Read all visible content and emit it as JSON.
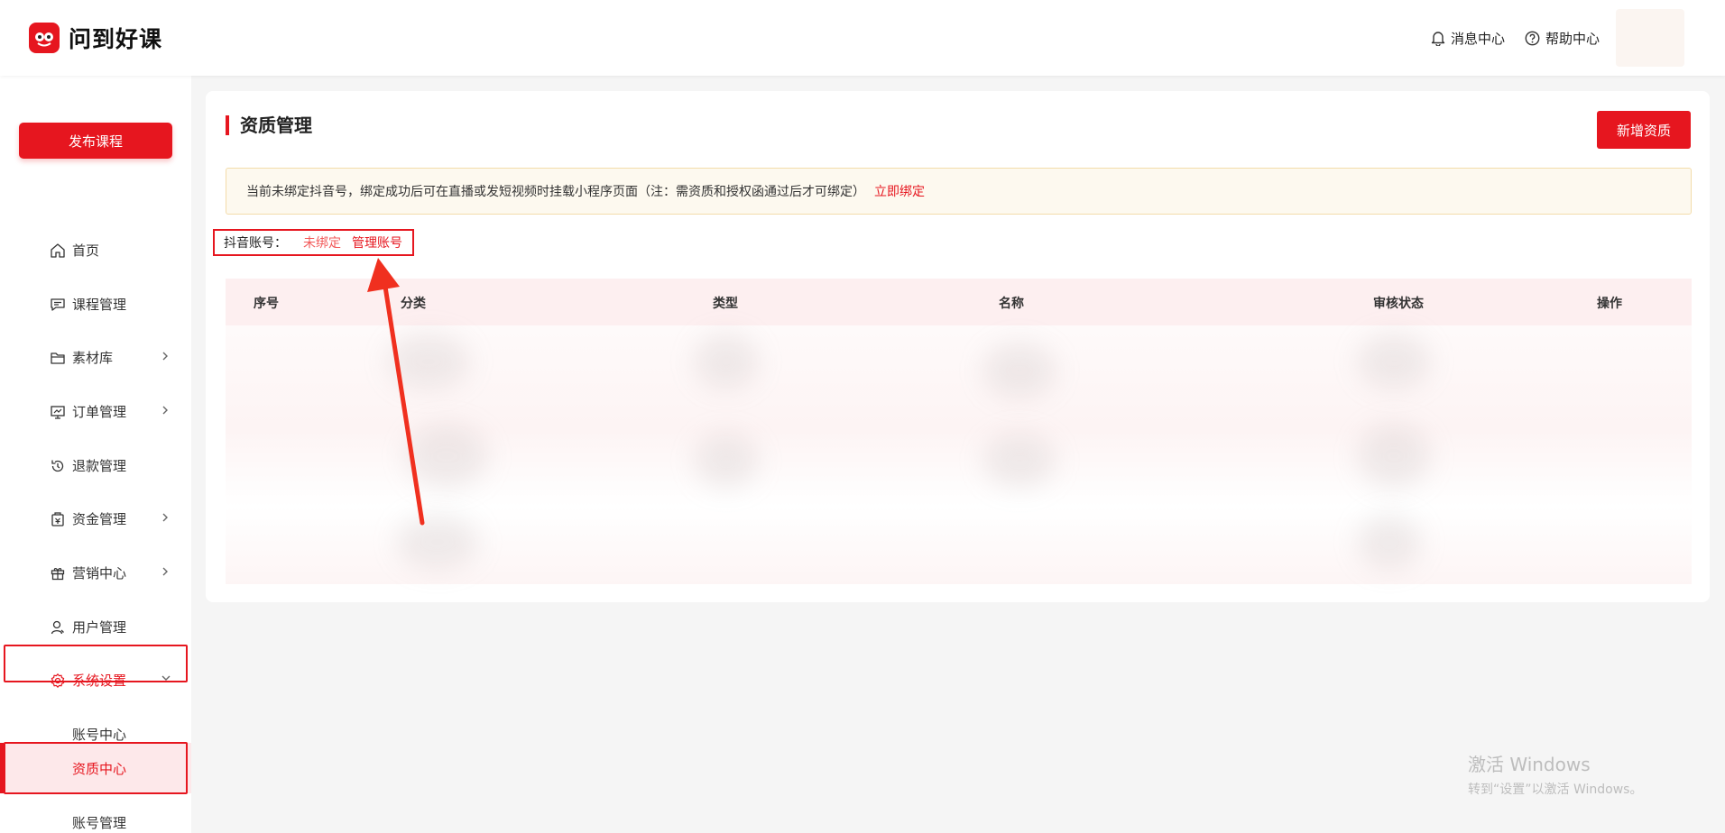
{
  "app": {
    "name": "问到好课"
  },
  "header": {
    "messages_label": "消息中心",
    "help_label": "帮助中心",
    "messages_icon": "bell-icon",
    "help_icon": "question-circle-icon"
  },
  "sidebar": {
    "publish_label": "发布课程",
    "items": [
      {
        "label": "首页",
        "icon": "home-icon"
      },
      {
        "label": "课程管理",
        "icon": "chat-list-icon"
      },
      {
        "label": "素材库",
        "icon": "folder-icon"
      },
      {
        "label": "订单管理",
        "icon": "monitor-icon"
      },
      {
        "label": "退款管理",
        "icon": "refund-icon"
      },
      {
        "label": "资金管理",
        "icon": "wallet-icon"
      },
      {
        "label": "营销中心",
        "icon": "gift-icon"
      },
      {
        "label": "用户管理",
        "icon": "user-icon"
      },
      {
        "label": "系统设置",
        "icon": "gear-icon"
      }
    ],
    "sub_items": [
      {
        "label": "账号中心"
      },
      {
        "label": "资质中心"
      },
      {
        "label": "账号管理"
      }
    ]
  },
  "main": {
    "title": "资质管理",
    "add_button": "新增资质",
    "notice_text": "当前未绑定抖音号，绑定成功后可在直播或发短视频时挂载小程序页面（注：需资质和授权函通过后才可绑定）",
    "notice_link": "立即绑定",
    "account_label": "抖音账号：",
    "account_status": "未绑定",
    "manage_link": "管理账号",
    "table_headers": [
      "序号",
      "分类",
      "类型",
      "名称",
      "审核状态",
      "操作"
    ]
  },
  "watermark": {
    "line1": "激活 Windows",
    "line2": "转到“设置”以激活 Windows。"
  },
  "colors": {
    "accent": "#e6161f"
  }
}
